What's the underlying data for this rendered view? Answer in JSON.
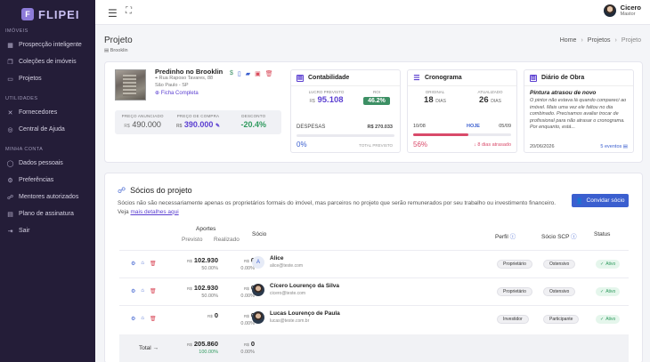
{
  "brand": {
    "name": "FLIPEI",
    "mark": "F"
  },
  "sidebar": {
    "sections": [
      {
        "title": "IMÓVEIS",
        "items": [
          {
            "label": "Prospecção inteligente",
            "icon": "grid-icon"
          },
          {
            "label": "Coleções de imóveis",
            "icon": "bookmark-icon"
          },
          {
            "label": "Projetos",
            "icon": "folder-icon"
          }
        ]
      },
      {
        "title": "UTILIDADES",
        "items": [
          {
            "label": "Fornecedores",
            "icon": "tools-icon"
          },
          {
            "label": "Central de Ajuda",
            "icon": "help-icon"
          }
        ]
      },
      {
        "title": "MINHA CONTA",
        "items": [
          {
            "label": "Dados pessoais",
            "icon": "user-icon"
          },
          {
            "label": "Preferências",
            "icon": "gear-icon"
          },
          {
            "label": "Mentores autorizados",
            "icon": "mentors-icon"
          },
          {
            "label": "Plano de assinatura",
            "icon": "card-icon"
          },
          {
            "label": "Sair",
            "icon": "logout-icon"
          }
        ]
      }
    ]
  },
  "topbar": {
    "user_name": "Cicero",
    "user_role": "Mastor"
  },
  "page": {
    "title": "Projeto",
    "subtitle": "Brooklin",
    "breadcrumb": [
      "Home",
      "Projetos",
      "Projeto"
    ]
  },
  "property": {
    "name": "Predinho no Brooklin",
    "address": "Rua Raposo Tavares, 88",
    "city": "São Paulo - SP",
    "sheet_link": "Ficha Completa",
    "prices": [
      {
        "label": "PREÇO ANUNCIADO",
        "currency": "R$",
        "value": "490.000",
        "color": "#555555"
      },
      {
        "label": "PREÇO DE COMPRA",
        "currency": "R$",
        "value": "390.000",
        "color": "#5b3fd1"
      },
      {
        "label": "DESCONTO",
        "currency": "",
        "value": "-20.4%",
        "color": "#2f9a5e"
      }
    ]
  },
  "contabilidade": {
    "title": "Contabilidade",
    "profit_label": "LUCRO PREVISTO",
    "profit_currency": "R$",
    "profit_value": "95.108",
    "roi_label": "ROI",
    "roi_value": "46.2%",
    "expenses_label": "DESPESAS",
    "expenses_value": "R$ 270.033",
    "expenses_pct": "0%",
    "expenses_progress": 0.0,
    "total_label": "TOTAL PREVISTO"
  },
  "cronograma": {
    "title": "Cronograma",
    "original_label": "ORIGINAL",
    "original_value": "18",
    "updated_label": "ATUALIZADO",
    "updated_value": "26",
    "days_unit": "DIAS",
    "start": "10/08",
    "today": "HOJE",
    "end": "05/09",
    "progress_pct": "56%",
    "progress": 0.56,
    "delay_text": "8 dias atrasado"
  },
  "diario": {
    "title": "Diário de Obra",
    "heading": "Pintura atrasou de novo",
    "text": "O pintor não estava lá quando compareci ao imóvel. Mais uma vez ele faltou no dia combinado. Precisamos avaliar trocar de profissional para não atrasar o cronograma. Por enquanto, está...",
    "date": "20/06/2026",
    "events": "5 eventos"
  },
  "socios": {
    "title": "Sócios do projeto",
    "description": "Sócios não são necessariamente apenas os proprietários formais do imóvel, mas parceiros no projeto que serão remunerados por seu trabalho ou investimento financeiro.",
    "see_more_prefix": "Veja",
    "see_more_link": "mais detalhes aqui",
    "invite_button": "Convidar sócio",
    "headers": {
      "aportes": "Aportes",
      "previsto": "Previsto",
      "realizado": "Realizado",
      "socio": "Sócio",
      "perfil": "Perfil",
      "socio_scp": "Sócio SCP",
      "status": "Status"
    },
    "rows": [
      {
        "prev": "102.930",
        "prev_pct": "50.00%",
        "real": "0",
        "real_pct": "0.00%",
        "name": "Alice",
        "email": "alice@teste.com",
        "avatar": "A",
        "perfil": "Proprietário",
        "scp": "Ostensivo",
        "status": "Ativo"
      },
      {
        "prev": "102.930",
        "prev_pct": "50.00%",
        "real": "0",
        "real_pct": "0.00%",
        "name": "Cícero Lourenço da Silva",
        "email": "cicero@teste.com",
        "avatar": "",
        "perfil": "Proprietário",
        "scp": "Ostensivo",
        "status": "Ativo"
      },
      {
        "prev": "0",
        "prev_pct": "",
        "real": "0",
        "real_pct": "0.00%",
        "name": "Lucas Lourenço de Paula",
        "email": "lucas@teste.com.br",
        "avatar": "",
        "perfil": "Investidor",
        "scp": "Participante",
        "status": "Ativo"
      }
    ],
    "total_label": "Total",
    "total_prev": "205.860",
    "total_prev_pct": "100.00%",
    "total_real": "0",
    "total_real_pct": "0.00%",
    "currency": "R$"
  }
}
